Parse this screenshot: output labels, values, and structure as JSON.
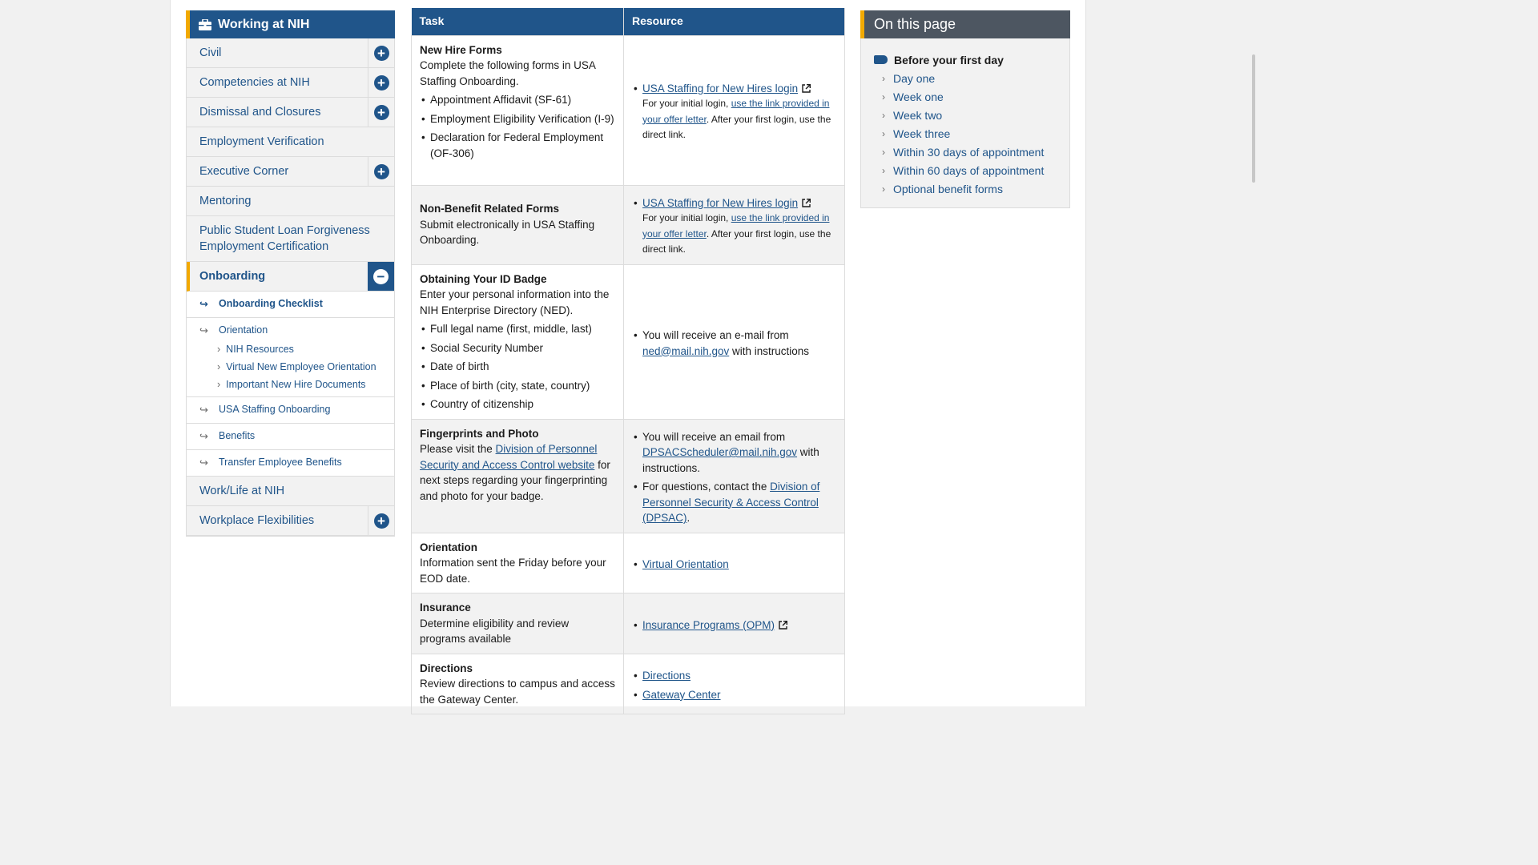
{
  "nav": {
    "title": "Working at NIH",
    "items": [
      {
        "label": "Civil",
        "toggle": "+"
      },
      {
        "label": "Competencies at NIH",
        "toggle": "+"
      },
      {
        "label": "Dismissal and Closures",
        "toggle": "+"
      },
      {
        "label": "Employment Verification",
        "toggle": ""
      },
      {
        "label": "Executive Corner",
        "toggle": "+"
      },
      {
        "label": "Mentoring",
        "toggle": ""
      },
      {
        "label": "Public Student Loan Forgiveness Employment Certification",
        "toggle": ""
      },
      {
        "label": "Onboarding",
        "toggle": "−"
      },
      {
        "label": "Work/Life at NIH",
        "toggle": ""
      },
      {
        "label": "Workplace Flexibilities",
        "toggle": "+"
      }
    ],
    "sub": {
      "checklist": "Onboarding Checklist",
      "orientation": "Orientation",
      "orientation_children": [
        "NIH Resources",
        "Virtual New Employee Orientation",
        "Important New Hire Documents"
      ],
      "usa_staffing": "USA Staffing Onboarding",
      "benefits": "Benefits",
      "transfer": "Transfer Employee Benefits"
    },
    "arrow": "↪",
    "chevron": "›"
  },
  "table": {
    "headers": {
      "task": "Task",
      "resource": "Resource"
    },
    "rows": [
      {
        "title": "New Hire Forms",
        "desc": "Complete the following forms in USA Staffing Onboarding.",
        "bullets": [
          "Appointment Affidavit (SF-61)",
          "Employment Eligibility Verification (I-9)",
          "Declaration for Federal Employment (OF-306)"
        ],
        "res_link": "USA Staffing for New Hires login",
        "res_note_a": "For your initial login, ",
        "res_note_link": "use the link provided in your offer letter",
        "res_note_b": ". After your first login, use the direct link."
      },
      {
        "title": "Non-Benefit Related Forms",
        "desc": "Submit electronically in USA Staffing Onboarding.",
        "res_link": "USA Staffing for New Hires login",
        "res_note_a": "For your initial login, ",
        "res_note_link": "use the link provided in your offer letter",
        "res_note_b": ". After your first login, use the direct link."
      },
      {
        "title": "Obtaining Your ID Badge",
        "desc": "Enter your personal information into the NIH Enterprise Directory (NED).",
        "bullets": [
          "Full legal name (first, middle, last)",
          "Social Security Number",
          "Date of birth",
          "Place of birth (city, state, country)",
          "Country of citizenship"
        ],
        "res_a": "You will receive an e-mail from ",
        "res_email": "ned@mail.nih.gov",
        "res_b": " with instructions"
      },
      {
        "title": "Fingerprints and Photo",
        "desc_a": "Please visit the ",
        "desc_link": "Division of Personnel Security and Access Control website",
        "desc_b": " for next steps regarding your fingerprinting and photo for your badge.",
        "res1_a": "You will receive an email from ",
        "res1_email": "DPSACScheduler@mail.nih.gov",
        "res1_b": " with instructions.",
        "res2_a": "For questions, contact the ",
        "res2_link": "Division of Personnel Security & Access Control (DPSAC)",
        "res2_b": "."
      },
      {
        "title": "Orientation",
        "desc": "Information sent the Friday before your EOD date.",
        "res_link": "Virtual Orientation"
      },
      {
        "title": "Insurance",
        "desc": "Determine eligibility and review programs available",
        "res_link": "Insurance Programs (OPM)"
      },
      {
        "title": "Directions",
        "desc": "Review directions to campus and access the Gateway Center.",
        "res_links": [
          "Directions",
          "Gateway Center"
        ]
      }
    ]
  },
  "on_this_page": {
    "title": "On this page",
    "current": "Before your first day",
    "items": [
      "Day one",
      "Week one",
      "Week two",
      "Week three",
      "Within 30 days of appointment",
      "Within 60 days of appointment",
      "Optional benefit forms"
    ]
  }
}
